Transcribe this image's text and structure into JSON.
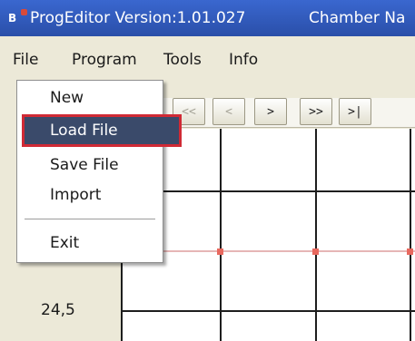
{
  "window": {
    "title": "ProgEditor Version:1.01.027",
    "chamber_text": "Chamber Na",
    "app_icon_glyph": "B"
  },
  "menubar": {
    "items": [
      "File",
      "Program",
      "Tools",
      "Info"
    ]
  },
  "file_menu": {
    "items": [
      "New",
      "Load File",
      "Save File",
      "Import",
      "Exit"
    ],
    "selected": "Load File",
    "selected_bg": "#3a4a6a",
    "highlight_border": "#d02a35"
  },
  "navigation": {
    "buttons": [
      "<<",
      "<",
      ">",
      ">>",
      ">|"
    ],
    "disabled": [
      "<<",
      "<"
    ]
  },
  "grid": {
    "row_label": "24,5",
    "marker_color": "#e8685e"
  },
  "colors": {
    "titlebar": "#2f58b8",
    "menubar": "#ece9d8"
  },
  "icons": {
    "app": "app-icon"
  }
}
